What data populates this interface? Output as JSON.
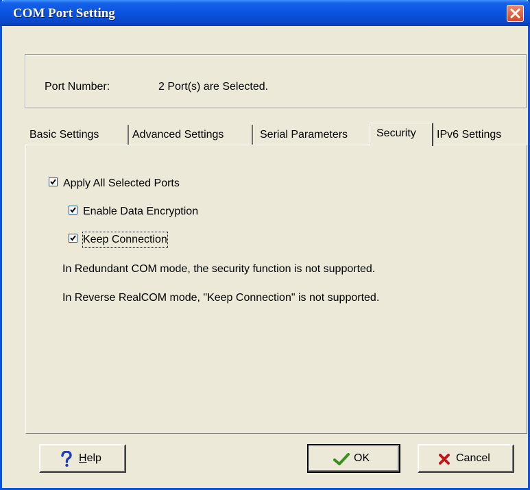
{
  "window": {
    "title": "COM Port Setting",
    "close_icon": "close-icon",
    "accent_color": "#0a53e0",
    "close_color": "#d44a28"
  },
  "port_info": {
    "label": "Port Number:",
    "value": "2 Port(s) are Selected."
  },
  "tabs": [
    {
      "label": "Basic Settings",
      "active": false
    },
    {
      "label": "Advanced Settings",
      "active": false
    },
    {
      "label": "Serial Parameters",
      "active": false
    },
    {
      "label": "Security",
      "active": true
    },
    {
      "label": "IPv6 Settings",
      "active": false
    }
  ],
  "security": {
    "apply_all": {
      "label": "Apply All Selected Ports",
      "checked": true
    },
    "enable_encryption": {
      "label": "Enable Data Encryption",
      "checked": true
    },
    "keep_connection": {
      "label": "Keep Connection",
      "checked": true,
      "focused": true
    },
    "notes": [
      "In Redundant COM mode,  the security function is not supported.",
      "In Reverse RealCOM mode, \"Keep Connection\" is not supported."
    ]
  },
  "buttons": {
    "help": {
      "mnemonic": "H",
      "rest": "elp",
      "icon": "question-icon"
    },
    "ok": {
      "label": "OK",
      "icon": "checkmark-icon"
    },
    "cancel": {
      "label": "Cancel",
      "icon": "x-icon"
    }
  }
}
